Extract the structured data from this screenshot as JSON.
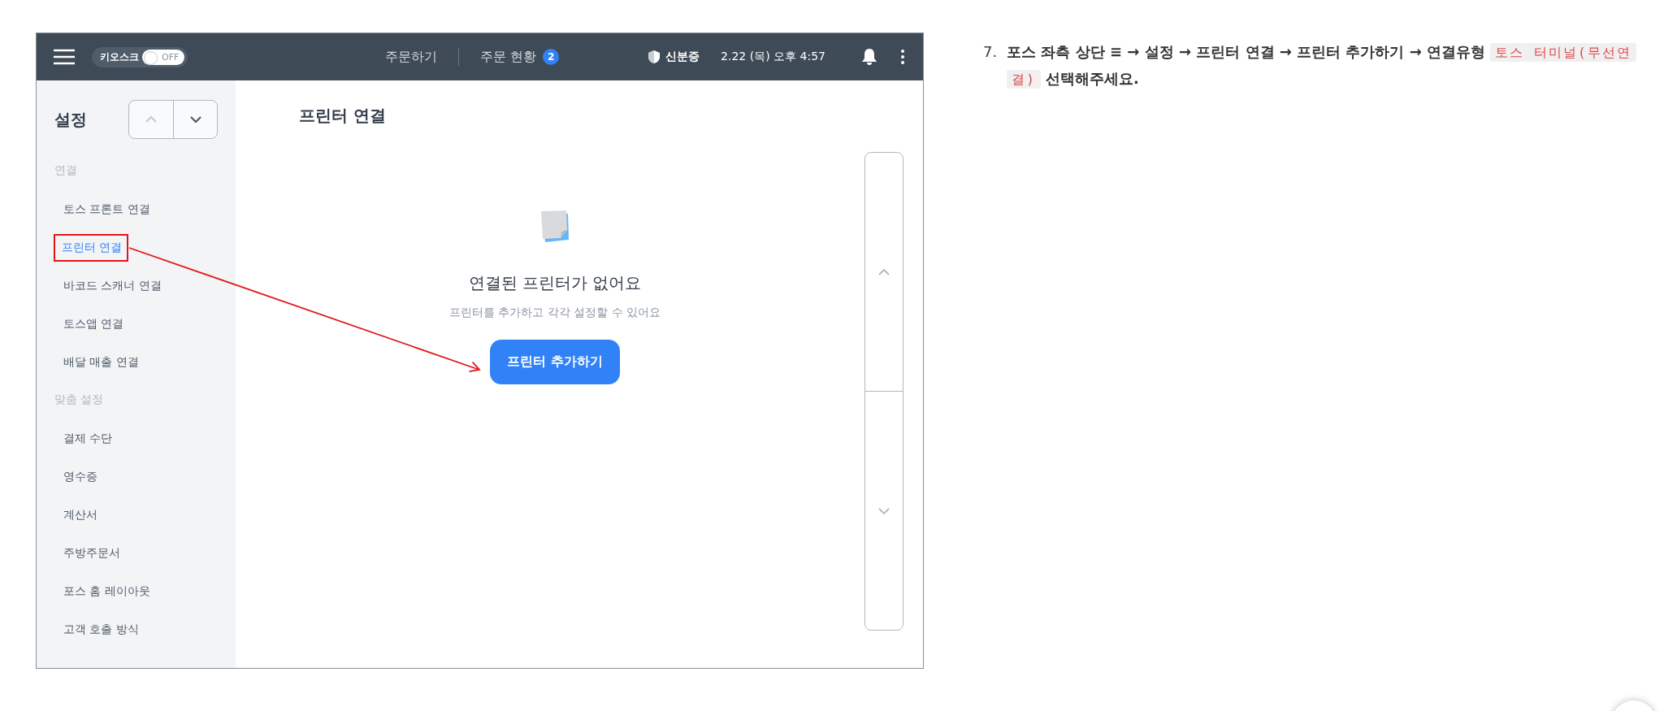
{
  "topbar": {
    "kiosk": {
      "label": "키오스크",
      "toggle_text": "OFF",
      "on": false
    },
    "nav": [
      {
        "label": "주문하기"
      },
      {
        "label": "주문 현황",
        "badge": "2"
      }
    ],
    "id_label": "신분증",
    "datetime": "2.22 (목) 오후 4:57"
  },
  "sidebar": {
    "title": "설정",
    "groups": [
      {
        "label": "연결",
        "items": [
          {
            "label": "토스 프론트 연결",
            "selected": false,
            "highlighted": false
          },
          {
            "label": "프린터 연결",
            "selected": true,
            "highlighted": true
          },
          {
            "label": "바코드 스캐너 연결",
            "selected": false,
            "highlighted": false
          },
          {
            "label": "토스앱 연결",
            "selected": false,
            "highlighted": false
          },
          {
            "label": "배달 매출 연결",
            "selected": false,
            "highlighted": false
          }
        ]
      },
      {
        "label": "맞춤 설정",
        "items": [
          {
            "label": "결제 수단",
            "selected": false,
            "highlighted": false
          },
          {
            "label": "영수증",
            "selected": false,
            "highlighted": false
          },
          {
            "label": "계산서",
            "selected": false,
            "highlighted": false
          },
          {
            "label": "주방주문서",
            "selected": false,
            "highlighted": false
          },
          {
            "label": "포스 홈 레이아웃",
            "selected": false,
            "highlighted": false
          },
          {
            "label": "고객 호출 방식",
            "selected": false,
            "highlighted": false
          }
        ]
      }
    ]
  },
  "content": {
    "title": "프린터 연결",
    "empty_title": "연결된 프린터가 없어요",
    "empty_text": "프린터를 추가하고 각각 설정할 수 있어요",
    "button": "프린터 추가하기"
  },
  "instruction": {
    "number": "7.",
    "text": "포스 좌측 상단 ≡ → 설정 → 프린터 연결  → 프린터 추가하기 → 연결유형",
    "code": "토스 터미널(무선연결)",
    "after": "선택해주세요."
  }
}
